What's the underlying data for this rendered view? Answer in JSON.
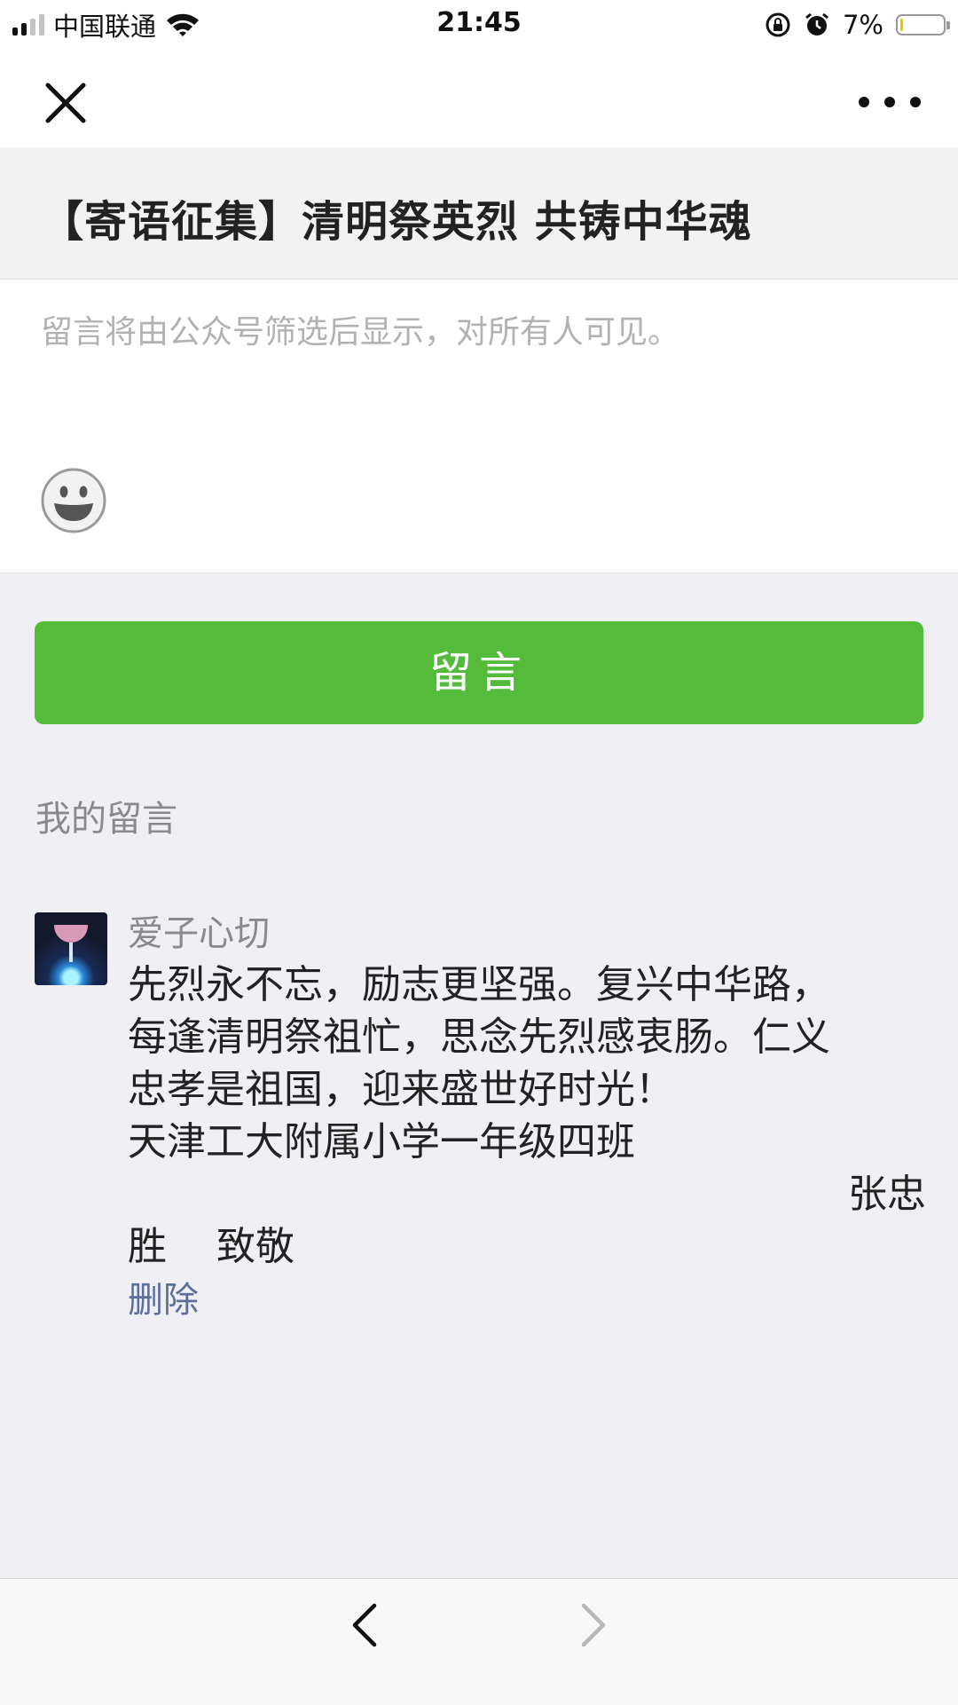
{
  "status_bar": {
    "carrier": "中国联通",
    "time": "21:45",
    "battery_percent": "7%",
    "battery_level": 0.07,
    "signal_bars": 4,
    "signal_bars_active": 2
  },
  "nav": {
    "close_icon": "close-icon",
    "more_icon": "more-dots-icon"
  },
  "article": {
    "title": "【寄语征集】清明祭英烈 共铸中华魂"
  },
  "compose": {
    "placeholder": "留言将由公众号筛选后显示，对所有人可见。",
    "emoji_icon": "emoji-smile-icon",
    "submit_label": "留言"
  },
  "my_comments": {
    "section_label": "我的留言",
    "items": [
      {
        "nickname": "爱子心切",
        "lines": [
          "先烈永不忘，励志更坚强。复兴中华路，",
          "每逢清明祭祖忙，思念先烈感衷肠。仁义",
          "忠孝是祖国，迎来盛世好时光！",
          "天津工大附属小学一年级四班"
        ],
        "sign_right": "张忠",
        "sign_left": "胜    致敬",
        "delete_label": "删除"
      }
    ]
  },
  "toolbar": {
    "back_icon": "chevron-left-icon",
    "forward_icon": "chevron-right-icon"
  },
  "colors": {
    "accent_green": "#55bb3a",
    "link_blue": "#5b7099",
    "background": "#efeff4"
  }
}
